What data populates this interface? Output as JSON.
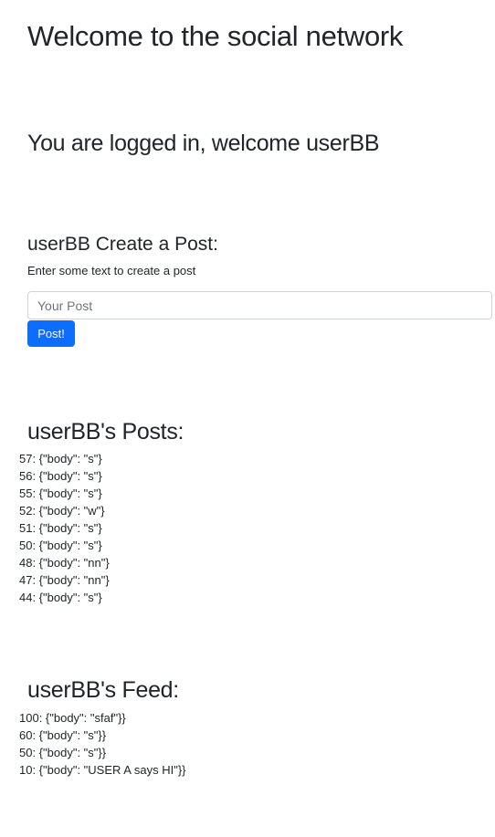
{
  "header": {
    "title": "Welcome to the social network",
    "logged_in_message": "You are logged in, welcome userBB"
  },
  "create_post": {
    "title": "userBB Create a Post:",
    "hint": "Enter some text to create a post",
    "placeholder": "Your Post",
    "button_label": "Post!"
  },
  "posts": {
    "title": "userBB's Posts:",
    "items": [
      "57: {\"body\": \"s\"}",
      "56: {\"body\": \"s\"}",
      "55: {\"body\": \"s\"}",
      "52: {\"body\": \"w\"}",
      "51: {\"body\": \"s\"}",
      "50: {\"body\": \"s\"}",
      "48: {\"body\": \"nn\"}",
      "47: {\"body\": \"nn\"}",
      "44: {\"body\": \"s\"}"
    ]
  },
  "feed": {
    "title": "userBB's Feed:",
    "items": [
      "100: {\"body\": \"sfaf\"}}",
      "60: {\"body\": \"s\"}}",
      "50: {\"body\": \"s\"}}",
      "10: {\"body\": \"USER A says HI\"}}"
    ]
  }
}
